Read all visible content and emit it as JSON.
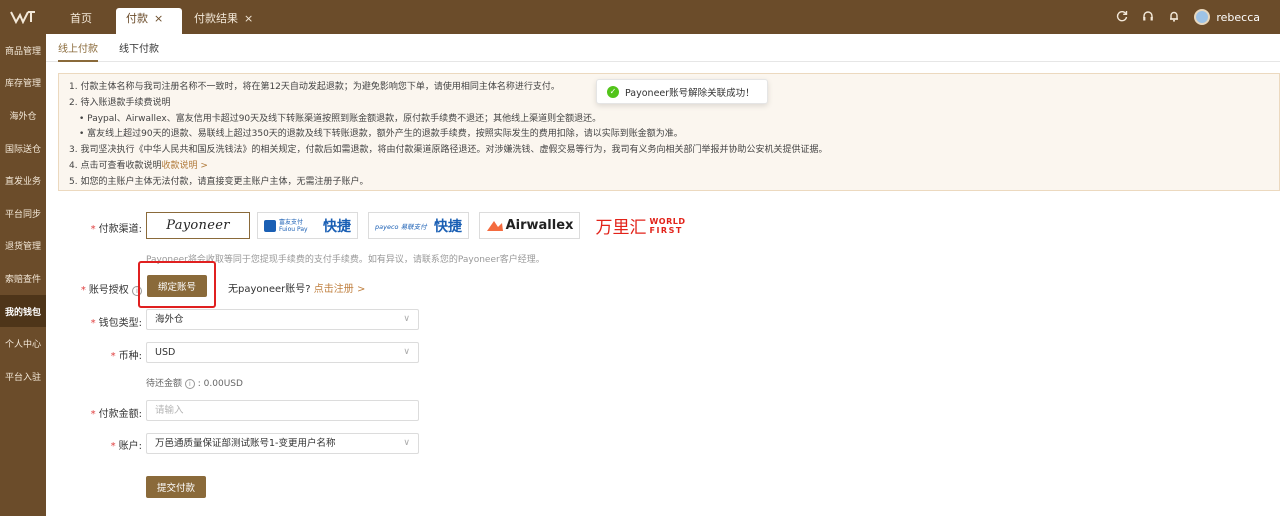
{
  "header": {
    "tabs": [
      {
        "label": "首页",
        "closable": false
      },
      {
        "label": "付款",
        "close": "×"
      },
      {
        "label": "付款结果",
        "close": "×"
      }
    ],
    "username": "rebecca"
  },
  "sidebar": {
    "items": [
      {
        "label": "商品管理"
      },
      {
        "label": "库存管理"
      },
      {
        "label": "海外仓"
      },
      {
        "label": "国际送仓"
      },
      {
        "label": "直发业务"
      },
      {
        "label": "平台同步"
      },
      {
        "label": "退货管理"
      },
      {
        "label": "索赔查件"
      },
      {
        "label": "我的钱包",
        "active": true
      },
      {
        "label": "个人中心"
      },
      {
        "label": "平台入驻"
      }
    ]
  },
  "subtabs": [
    {
      "label": "线上付款",
      "active": true
    },
    {
      "label": "线下付款"
    }
  ],
  "notice": {
    "lines": [
      "1. 付款主体名称与我司注册名称不一致时，将在第12天自动发起退款；为避免影响您下单，请使用相同主体名称进行支付。",
      "2. 待入账退款手续费说明",
      "•  Paypal、Airwallex、富友信用卡超过90天及线下转账渠道按照到账金额退款，原付款手续费不退还；其他线上渠道则全额退还。",
      "•  富友线上超过90天的退款、易联线上超过350天的退款及线下转账退款，额外产生的退款手续费，按照实际发生的费用扣除，请以实际到账金额为准。",
      "3. 我司坚决执行《中华人民共和国反洗钱法》的相关规定，付款后如需退款，将由付款渠道原路径退还。对涉嫌洗钱、虚假交易等行为，我司有义务向相关部门举报并协助公安机关提供证据。",
      "4. 点击可查看收款说明",
      "5. 如您的主账户主体无法付款，请直接变更主账户主体，无需注册子账户。"
    ],
    "link": "收款说明 >"
  },
  "toast": {
    "message": "Payoneer账号解除关联成功！"
  },
  "form": {
    "channel_label": "付款渠道:",
    "channels": [
      {
        "name": "Payoneer",
        "selected": true
      },
      {
        "name": "富友支付 Fuiou Pay",
        "tag": "快捷"
      },
      {
        "name": "payeco 易联支付",
        "tag": "快捷"
      },
      {
        "name": "Airwallex"
      },
      {
        "name": "万里汇",
        "sub1": "WORLD",
        "sub2": "FIRST"
      }
    ],
    "channel_hint": "Payoneer将会收取等同于您提现手续费的支付手续费。如有异议，请联系您的Payoneer客户经理。",
    "auth_label": "账号授权",
    "bind_button": "绑定账号",
    "no_account": "无payoneer账号?",
    "register_link": "点击注册 >",
    "wallet_label": "钱包类型:",
    "wallet_value": "海外仓",
    "currency_label": "币种:",
    "currency_value": "USD",
    "pending_label": "待还金额",
    "pending_value": "0.00USD",
    "amount_label": "付款金额:",
    "amount_placeholder": "请输入",
    "account_label": "账户:",
    "account_value": "万邑通质量保证部测试账号1-变更用户名称",
    "submit_button": "提交付款"
  },
  "colors": {
    "brand": "#6b4c2a",
    "accent": "#8a6a3a",
    "highlight_box": "#e02020",
    "success": "#52c41a"
  }
}
